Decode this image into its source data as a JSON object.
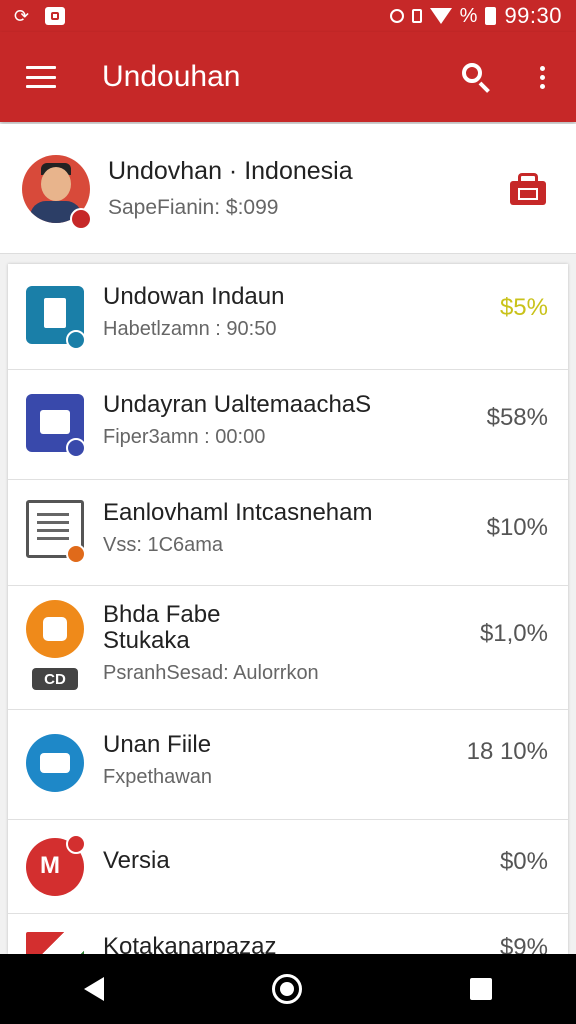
{
  "statusbar": {
    "battery_text": "%",
    "time": "99:30"
  },
  "appbar": {
    "title": "Undouhan"
  },
  "profile": {
    "name": "Undovhan · Indonesia",
    "subtitle": "SapeFianin: $:099"
  },
  "items": [
    {
      "title": "Undowan Indaun",
      "subtitle": "Habetlzamn : 90:50",
      "value": "$5%",
      "value_color": "#c9c21a",
      "icon": "document-icon",
      "icon_color": "#1a7fa8"
    },
    {
      "title": "Undayran UaltemaachaS",
      "subtitle": "Fiper3amn : 00:00",
      "value": "$58%",
      "value_color": "#555555",
      "icon": "printer-icon",
      "icon_color": "#3949ab"
    },
    {
      "title": "Eanlovhaml Intcasneham",
      "subtitle": "Vss: 1C6ama",
      "value": "$10%",
      "value_color": "#555555",
      "icon": "spreadsheet-icon",
      "icon_color": "#555555"
    },
    {
      "title": "Bhda Fabe",
      "title2": "Stukaka",
      "subtitle": "PsranhSesad: Aulorrkon",
      "tag": "CD",
      "value": "$1,0%",
      "value_color": "#555555",
      "icon": "chat-bubble-icon",
      "icon_color": "#ef8a1a"
    },
    {
      "title": "Unan Fiile",
      "subtitle": "Fxpethawan",
      "value": "18 10%",
      "value_color": "#555555",
      "icon": "message-icon",
      "icon_color": "#1e88c8"
    },
    {
      "title": "Versia",
      "value": "$0%",
      "value_color": "#555555",
      "icon": "heart-icon",
      "icon_color": "#d32f2f"
    },
    {
      "title": "Kotakanarpazaz",
      "value": "$9%",
      "value_color": "#555555",
      "icon": "flag-icon"
    }
  ],
  "colors": {
    "primary": "#c62828",
    "accent_value": "#c9c21a"
  }
}
